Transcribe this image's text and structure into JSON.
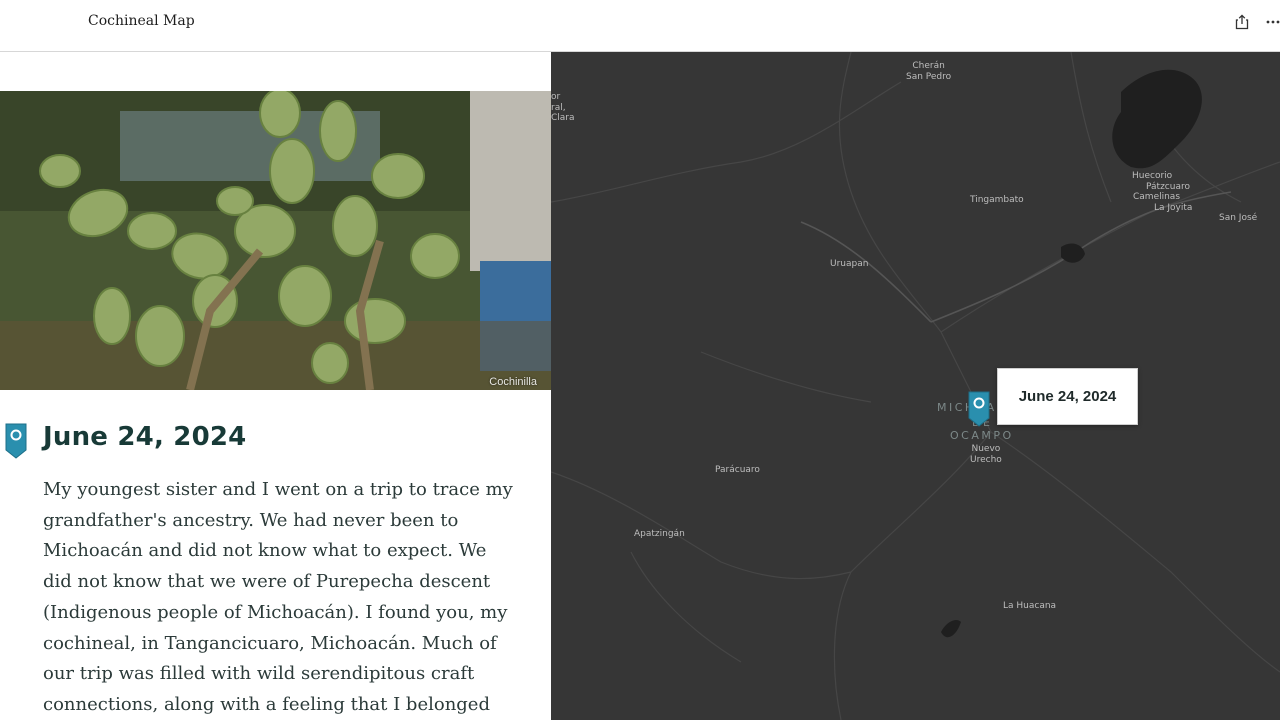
{
  "app": {
    "title": "Cochineal Map"
  },
  "header": {
    "share_icon": "share-icon",
    "more_icon": "more-icon"
  },
  "narrative": {
    "photo": {
      "caption": "Cochinilla",
      "subject": "prickly-pear-cactus"
    },
    "entry": {
      "pin_icon": "map-pin-icon",
      "title": "June 24, 2024",
      "body": "My youngest sister and I went on a trip to trace my grandfather's ancestry. We had never been to Michoacán and did not know what to expect. We did not know that we were of Purepecha descent (Indigenous people of Michoacán). I found you, my cochineal, in Tangancicuaro, Michoacán. Much of our trip was filled with wild serendipitous craft connections, along with a feeling that I belonged"
    }
  },
  "map": {
    "places": {
      "cheran": "Cherán",
      "san_pedro": "San Pedro",
      "clara_1": "or",
      "clara_2": "ral,",
      "clara_3": "Clara",
      "tingambato": "Tingambato",
      "uruapan": "Uruapan",
      "huecorio": "Huecorio",
      "patzcuaro": "Pátzcuaro",
      "camelinas": "Camelinas",
      "la_joyita": "La Joyita",
      "san_jose": "San José",
      "paracuaro": "Parácuaro",
      "apatzingan": "Apatzingán",
      "nuevo_urecho_1": "Nuevo",
      "nuevo_urecho_2": "Urecho",
      "la_huacana": "La Huacana"
    },
    "region": {
      "line1": "MICHOAC",
      "line2": "DE",
      "line3": "OCAMPO"
    },
    "marker": {
      "icon": "map-pin-icon",
      "tooltip": "June 24, 2024"
    },
    "colors": {
      "background": "#363636",
      "pin": "#2a8fae",
      "water": "#1f1f1f"
    }
  }
}
